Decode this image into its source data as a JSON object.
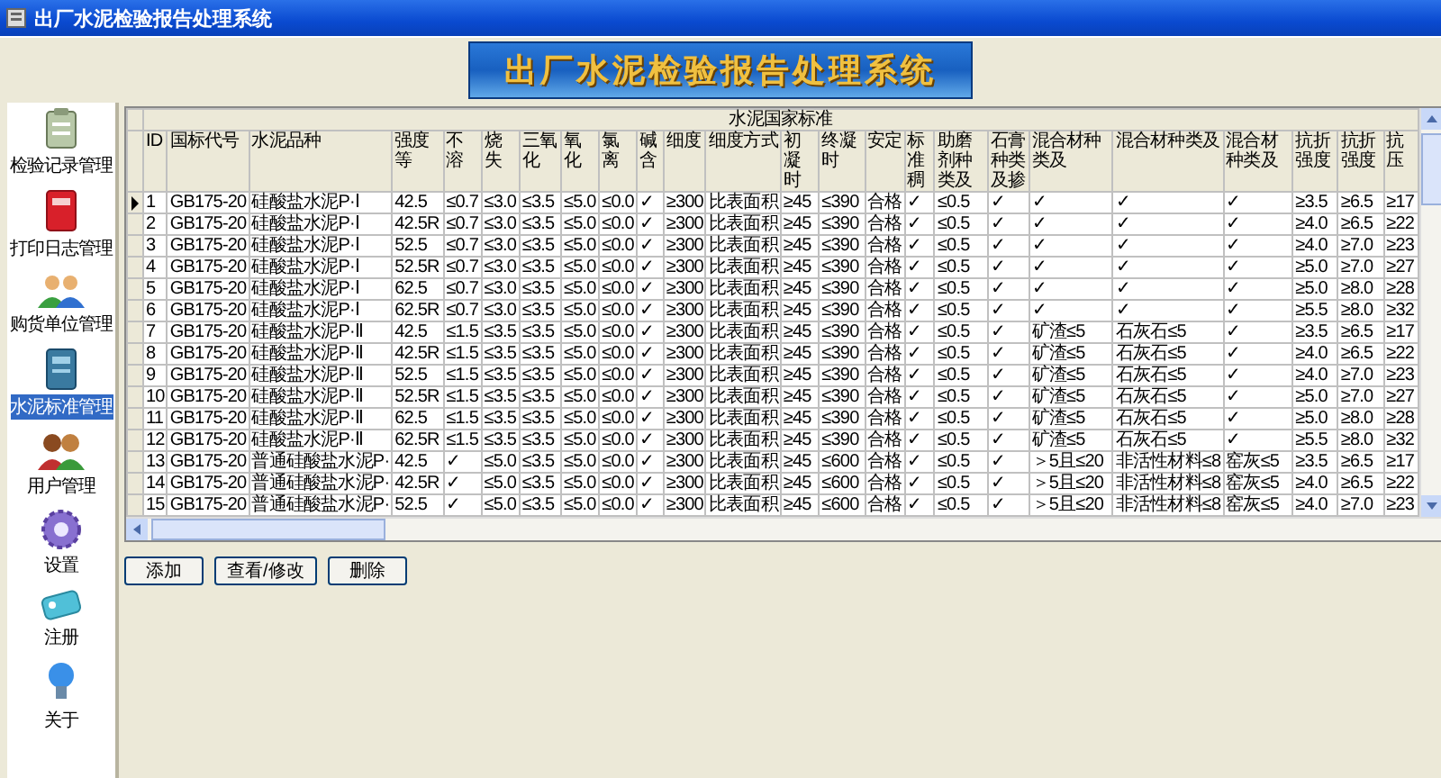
{
  "window": {
    "title": "出厂水泥检验报告处理系统"
  },
  "banner": {
    "title": "出厂水泥检验报告处理系统"
  },
  "sidebar": {
    "items": [
      {
        "label": "检验记录管理",
        "selected": false
      },
      {
        "label": "打印日志管理",
        "selected": false
      },
      {
        "label": "购货单位管理",
        "selected": false
      },
      {
        "label": "水泥标准管理",
        "selected": true
      },
      {
        "label": "用户管理",
        "selected": false
      },
      {
        "label": "设置",
        "selected": false
      },
      {
        "label": "注册",
        "selected": false
      },
      {
        "label": "关于",
        "selected": false
      }
    ]
  },
  "grid": {
    "caption": "水泥国家标准",
    "columns": [
      "ID",
      "国标代号",
      "水泥品种",
      "强度等",
      "不溶",
      "烧失",
      "三氧化",
      "氧化",
      "氯离",
      "碱含",
      "细度",
      "细度方式",
      "初凝时",
      "终凝时",
      "安定",
      "标准稠",
      "助磨剂种类及",
      "石膏种类及掺",
      "混合材种类及",
      "混合材种类及",
      "混合材种类及",
      "抗折强度",
      "抗折强度",
      "抗压"
    ],
    "rows": [
      {
        "selected": true,
        "cells": [
          "1",
          "GB175-20",
          "硅酸盐水泥P·Ⅰ",
          "42.5",
          "≤0.7",
          "≤3.0",
          "≤3.5",
          "≤5.0",
          "≤0.0",
          "✓",
          "≥300",
          "比表面积",
          "≥45",
          "≤390",
          "合格",
          "✓",
          "≤0.5",
          "✓",
          "✓",
          "✓",
          "✓",
          "≥3.5",
          "≥6.5",
          "≥17"
        ]
      },
      {
        "selected": false,
        "cells": [
          "2",
          "GB175-20",
          "硅酸盐水泥P·Ⅰ",
          "42.5R",
          "≤0.7",
          "≤3.0",
          "≤3.5",
          "≤5.0",
          "≤0.0",
          "✓",
          "≥300",
          "比表面积",
          "≥45",
          "≤390",
          "合格",
          "✓",
          "≤0.5",
          "✓",
          "✓",
          "✓",
          "✓",
          "≥4.0",
          "≥6.5",
          "≥22"
        ]
      },
      {
        "selected": false,
        "cells": [
          "3",
          "GB175-20",
          "硅酸盐水泥P·Ⅰ",
          "52.5",
          "≤0.7",
          "≤3.0",
          "≤3.5",
          "≤5.0",
          "≤0.0",
          "✓",
          "≥300",
          "比表面积",
          "≥45",
          "≤390",
          "合格",
          "✓",
          "≤0.5",
          "✓",
          "✓",
          "✓",
          "✓",
          "≥4.0",
          "≥7.0",
          "≥23"
        ]
      },
      {
        "selected": false,
        "cells": [
          "4",
          "GB175-20",
          "硅酸盐水泥P·Ⅰ",
          "52.5R",
          "≤0.7",
          "≤3.0",
          "≤3.5",
          "≤5.0",
          "≤0.0",
          "✓",
          "≥300",
          "比表面积",
          "≥45",
          "≤390",
          "合格",
          "✓",
          "≤0.5",
          "✓",
          "✓",
          "✓",
          "✓",
          "≥5.0",
          "≥7.0",
          "≥27"
        ]
      },
      {
        "selected": false,
        "cells": [
          "5",
          "GB175-20",
          "硅酸盐水泥P·Ⅰ",
          "62.5",
          "≤0.7",
          "≤3.0",
          "≤3.5",
          "≤5.0",
          "≤0.0",
          "✓",
          "≥300",
          "比表面积",
          "≥45",
          "≤390",
          "合格",
          "✓",
          "≤0.5",
          "✓",
          "✓",
          "✓",
          "✓",
          "≥5.0",
          "≥8.0",
          "≥28"
        ]
      },
      {
        "selected": false,
        "cells": [
          "6",
          "GB175-20",
          "硅酸盐水泥P·Ⅰ",
          "62.5R",
          "≤0.7",
          "≤3.0",
          "≤3.5",
          "≤5.0",
          "≤0.0",
          "✓",
          "≥300",
          "比表面积",
          "≥45",
          "≤390",
          "合格",
          "✓",
          "≤0.5",
          "✓",
          "✓",
          "✓",
          "✓",
          "≥5.5",
          "≥8.0",
          "≥32"
        ]
      },
      {
        "selected": false,
        "cells": [
          "7",
          "GB175-20",
          "硅酸盐水泥P·Ⅱ",
          "42.5",
          "≤1.5",
          "≤3.5",
          "≤3.5",
          "≤5.0",
          "≤0.0",
          "✓",
          "≥300",
          "比表面积",
          "≥45",
          "≤390",
          "合格",
          "✓",
          "≤0.5",
          "✓",
          "矿渣≤5",
          "石灰石≤5",
          "✓",
          "≥3.5",
          "≥6.5",
          "≥17"
        ]
      },
      {
        "selected": false,
        "cells": [
          "8",
          "GB175-20",
          "硅酸盐水泥P·Ⅱ",
          "42.5R",
          "≤1.5",
          "≤3.5",
          "≤3.5",
          "≤5.0",
          "≤0.0",
          "✓",
          "≥300",
          "比表面积",
          "≥45",
          "≤390",
          "合格",
          "✓",
          "≤0.5",
          "✓",
          "矿渣≤5",
          "石灰石≤5",
          "✓",
          "≥4.0",
          "≥6.5",
          "≥22"
        ]
      },
      {
        "selected": false,
        "cells": [
          "9",
          "GB175-20",
          "硅酸盐水泥P·Ⅱ",
          "52.5",
          "≤1.5",
          "≤3.5",
          "≤3.5",
          "≤5.0",
          "≤0.0",
          "✓",
          "≥300",
          "比表面积",
          "≥45",
          "≤390",
          "合格",
          "✓",
          "≤0.5",
          "✓",
          "矿渣≤5",
          "石灰石≤5",
          "✓",
          "≥4.0",
          "≥7.0",
          "≥23"
        ]
      },
      {
        "selected": false,
        "cells": [
          "10",
          "GB175-20",
          "硅酸盐水泥P·Ⅱ",
          "52.5R",
          "≤1.5",
          "≤3.5",
          "≤3.5",
          "≤5.0",
          "≤0.0",
          "✓",
          "≥300",
          "比表面积",
          "≥45",
          "≤390",
          "合格",
          "✓",
          "≤0.5",
          "✓",
          "矿渣≤5",
          "石灰石≤5",
          "✓",
          "≥5.0",
          "≥7.0",
          "≥27"
        ]
      },
      {
        "selected": false,
        "cells": [
          "11",
          "GB175-20",
          "硅酸盐水泥P·Ⅱ",
          "62.5",
          "≤1.5",
          "≤3.5",
          "≤3.5",
          "≤5.0",
          "≤0.0",
          "✓",
          "≥300",
          "比表面积",
          "≥45",
          "≤390",
          "合格",
          "✓",
          "≤0.5",
          "✓",
          "矿渣≤5",
          "石灰石≤5",
          "✓",
          "≥5.0",
          "≥8.0",
          "≥28"
        ]
      },
      {
        "selected": false,
        "cells": [
          "12",
          "GB175-20",
          "硅酸盐水泥P·Ⅱ",
          "62.5R",
          "≤1.5",
          "≤3.5",
          "≤3.5",
          "≤5.0",
          "≤0.0",
          "✓",
          "≥300",
          "比表面积",
          "≥45",
          "≤390",
          "合格",
          "✓",
          "≤0.5",
          "✓",
          "矿渣≤5",
          "石灰石≤5",
          "✓",
          "≥5.5",
          "≥8.0",
          "≥32"
        ]
      },
      {
        "selected": false,
        "cells": [
          "13",
          "GB175-20",
          "普通硅酸盐水泥P·",
          "42.5",
          "✓",
          "≤5.0",
          "≤3.5",
          "≤5.0",
          "≤0.0",
          "✓",
          "≥300",
          "比表面积",
          "≥45",
          "≤600",
          "合格",
          "✓",
          "≤0.5",
          "✓",
          "＞5且≤20",
          "非活性材料≤8",
          "窑灰≤5",
          "≥3.5",
          "≥6.5",
          "≥17"
        ]
      },
      {
        "selected": false,
        "cells": [
          "14",
          "GB175-20",
          "普通硅酸盐水泥P·",
          "42.5R",
          "✓",
          "≤5.0",
          "≤3.5",
          "≤5.0",
          "≤0.0",
          "✓",
          "≥300",
          "比表面积",
          "≥45",
          "≤600",
          "合格",
          "✓",
          "≤0.5",
          "✓",
          "＞5且≤20",
          "非活性材料≤8",
          "窑灰≤5",
          "≥4.0",
          "≥6.5",
          "≥22"
        ]
      },
      {
        "selected": false,
        "cells": [
          "15",
          "GB175-20",
          "普通硅酸盐水泥P·",
          "52.5",
          "✓",
          "≤5.0",
          "≤3.5",
          "≤5.0",
          "≤0.0",
          "✓",
          "≥300",
          "比表面积",
          "≥45",
          "≤600",
          "合格",
          "✓",
          "≤0.5",
          "✓",
          "＞5且≤20",
          "非活性材料≤8",
          "窑灰≤5",
          "≥4.0",
          "≥7.0",
          "≥23"
        ]
      }
    ]
  },
  "buttons": [
    "添加",
    "查看/修改",
    "删除"
  ]
}
